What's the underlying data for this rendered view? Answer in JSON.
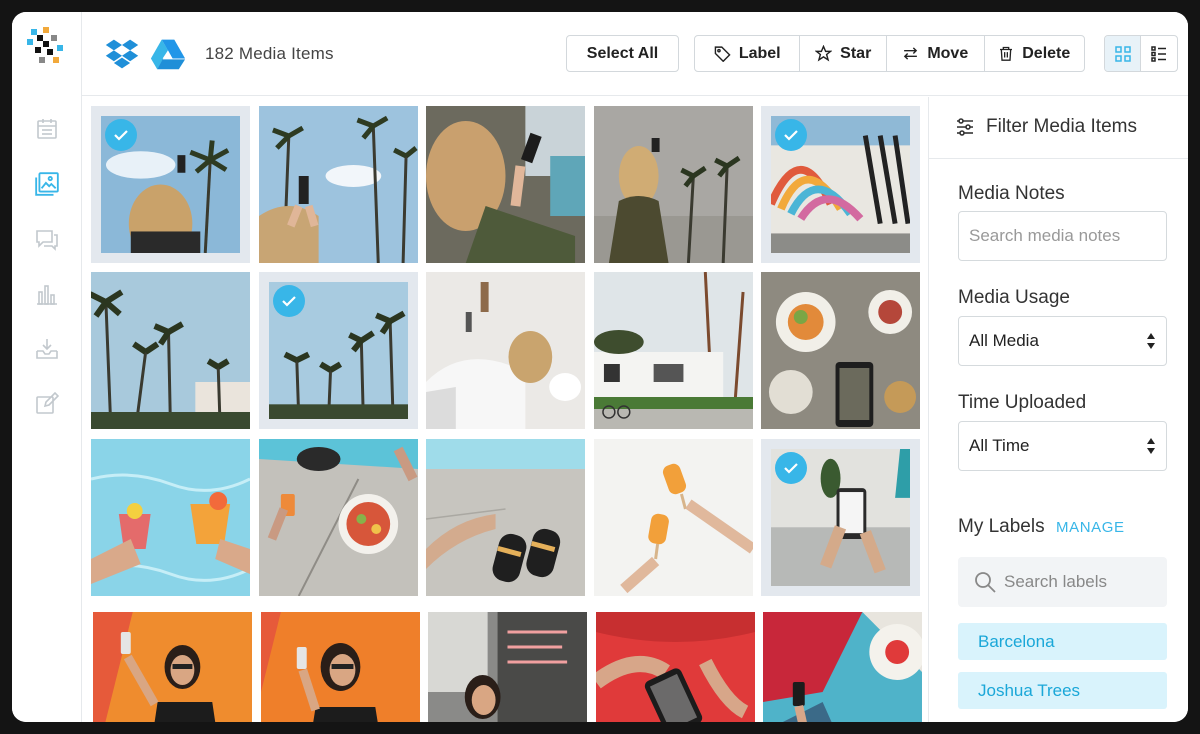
{
  "header": {
    "count_label": "182 Media Items",
    "select_all": "Select All",
    "actions": [
      {
        "label": "Label",
        "icon": "tag-icon"
      },
      {
        "label": "Star",
        "icon": "star-icon"
      },
      {
        "label": "Move",
        "icon": "move-arrows-icon"
      },
      {
        "label": "Delete",
        "icon": "trash-icon"
      }
    ],
    "sources": [
      "dropbox-icon",
      "google-drive-icon"
    ],
    "views": [
      "grid-view-icon",
      "list-view-icon"
    ]
  },
  "rail": {
    "items": [
      "calendar-icon",
      "media-library-icon",
      "messages-icon",
      "analytics-icon",
      "inbox-download-icon",
      "edit-post-icon"
    ],
    "active": "media-library-icon"
  },
  "grid": {
    "tiles": [
      {
        "name": "woman-phone-palms",
        "selected": true
      },
      {
        "name": "palms-phone-photo",
        "selected": false
      },
      {
        "name": "woman-phone-pool",
        "selected": false
      },
      {
        "name": "woman-phone-wall",
        "selected": false
      },
      {
        "name": "rainbow-mural",
        "selected": true
      },
      {
        "name": "palm-trees-building",
        "selected": false
      },
      {
        "name": "palm-trees-sky",
        "selected": true
      },
      {
        "name": "white-bedroom",
        "selected": false
      },
      {
        "name": "white-house-palms",
        "selected": false
      },
      {
        "name": "food-table-phone",
        "selected": false
      },
      {
        "name": "pool-cocktails",
        "selected": false
      },
      {
        "name": "poolside-skewers",
        "selected": false
      },
      {
        "name": "sandals-feet",
        "selected": false
      },
      {
        "name": "popsicles",
        "selected": false
      },
      {
        "name": "phone-sofa",
        "selected": true
      },
      {
        "name": "selfie-orange-wall-1",
        "selected": false
      },
      {
        "name": "selfie-orange-wall-2",
        "selected": false
      },
      {
        "name": "neon-sign-cafe",
        "selected": false
      },
      {
        "name": "phone-red-chair",
        "selected": false
      },
      {
        "name": "phone-colorful-wall",
        "selected": false
      }
    ]
  },
  "filter": {
    "title": "Filter Media Items",
    "notes_label": "Media Notes",
    "notes_placeholder": "Search media notes",
    "usage_label": "Media Usage",
    "usage_value": "All Media",
    "time_label": "Time Uploaded",
    "time_value": "All Time",
    "labels_title": "My Labels",
    "manage": "MANAGE",
    "labels_placeholder": "Search labels",
    "labels": [
      "Barcelona",
      "Joshua Trees"
    ]
  },
  "colors": {
    "accent": "#38b6e8",
    "chip_bg": "#d9f3fc",
    "border": "#d3d8dc"
  }
}
